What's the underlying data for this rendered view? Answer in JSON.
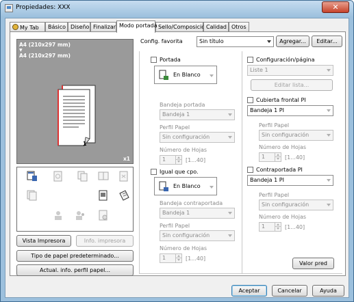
{
  "window": {
    "title": "Propiedades: XXX",
    "close_glyph": "✕"
  },
  "tabs": [
    "My Tab",
    "Básico",
    "Diseño",
    "Finalizar",
    "Modo portada",
    "Sello/Composición",
    "Calidad",
    "Otros"
  ],
  "favorites": {
    "label": "Config. favorita",
    "value": "Sin título",
    "add": "Agregar...",
    "edit": "Editar..."
  },
  "preview": {
    "line1": "A4 (210x297 mm)",
    "arrow": "▼",
    "line2": "A4 (210x297 mm)",
    "page_number": "1",
    "count": "x1"
  },
  "left_buttons": {
    "printer_view": "Vista Impresora",
    "printer_info": "Info. impresora",
    "paper_type": "Tipo de papel predeterminado...",
    "update_profile": "Actual. info. perfil papel..."
  },
  "cover": {
    "label": "Portada",
    "tray_option": "En Blanco",
    "tray_label": "Bandeja portada",
    "tray_value": "Bandeja 1",
    "profile_label": "Perfil Papel",
    "profile_value": "Sin configuración",
    "sheets_label": "Número de Hojas",
    "sheets_value": "1",
    "sheets_range": "[1...40]"
  },
  "back_cover": {
    "label": "Igual que cpo.",
    "tray_option": "En Blanco",
    "tray_label": "Bandeja contraportada",
    "tray_value": "Bandeja 1",
    "profile_label": "Perfil Papel",
    "profile_value": "Sin configuración",
    "sheets_label": "Número de Hojas",
    "sheets_value": "1",
    "sheets_range": "[1...40]"
  },
  "page_config": {
    "label": "Configuración/página",
    "list_value": "Liste 1",
    "edit_list": "Editar lista..."
  },
  "front_cover_pi": {
    "label": "Cubierta frontal PI",
    "tray_value": "Bandeja 1 PI",
    "profile_label": "Perfil Papel",
    "profile_value": "Sin configuración",
    "sheets_label": "Número de Hojas",
    "sheets_value": "1",
    "sheets_range": "[1...40]"
  },
  "back_cover_pi": {
    "label": "Contraportada PI",
    "tray_value": "Bandeja 1 PI",
    "profile_label": "Perfil Papel",
    "profile_value": "Sin configuración",
    "sheets_label": "Número de Hojas",
    "sheets_value": "1",
    "sheets_range": "[1...40]"
  },
  "default_button": "Valor pred",
  "footer": {
    "accept": "Aceptar",
    "cancel": "Cancelar",
    "help": "Ayuda"
  },
  "colors": {
    "title_bar": "#9cc0dd",
    "close": "#c7432a",
    "preview_bg": "#9a9a9a",
    "dialog_bg": "#f0f0f0"
  }
}
